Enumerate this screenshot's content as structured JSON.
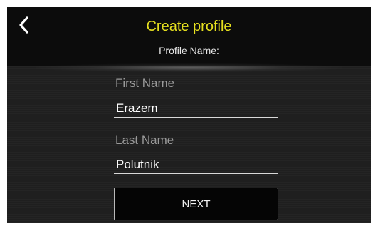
{
  "header": {
    "title": "Create profile",
    "subtitle": "Profile Name:",
    "back_icon": "chevron-left-icon"
  },
  "form": {
    "first_name_label": "First Name",
    "first_name_value": "Erazem",
    "last_name_label": "Last Name",
    "last_name_value": "Polutnik"
  },
  "actions": {
    "next_label": "NEXT"
  },
  "colors": {
    "title": "#e6e01f",
    "background": "#1f1f1f",
    "header": "#0c0c0c",
    "label": "#9a9a9a",
    "text": "#ffffff"
  }
}
